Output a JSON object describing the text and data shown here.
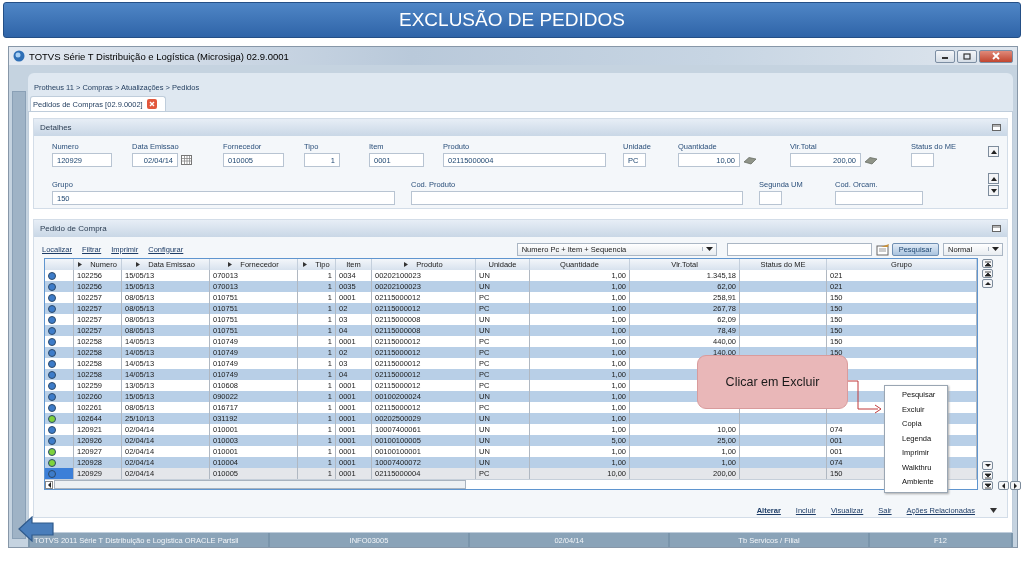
{
  "slide_title": "EXCLUSÃO DE PEDIDOS",
  "window": {
    "title": "TOTVS Série T Distribuição e Logística (Microsiga) 02.9.0001"
  },
  "breadcrumb": "Protheus 11 > Compras  > Atualizações > Pedidos",
  "tab": {
    "label": "Pedidos de Compras [02.9.0002]",
    "selected": true
  },
  "details": {
    "title": "Detalhes",
    "fields": [
      {
        "label": "Numero",
        "value": "120929",
        "kind": "text"
      },
      {
        "label": "Data Emissao",
        "value": "02/04/14",
        "kind": "date"
      },
      {
        "label": "Fornecedor",
        "value": "010005",
        "kind": "text"
      },
      {
        "label": "Tipo",
        "value": "1",
        "kind": "number"
      },
      {
        "label": "Item",
        "value": "0001",
        "kind": "text"
      },
      {
        "label": "Produto",
        "value": "02115000004",
        "kind": "text"
      },
      {
        "label": "Unidade",
        "value": "PC",
        "kind": "text"
      },
      {
        "label": "Quantidade",
        "value": "10,00",
        "kind": "amount"
      },
      {
        "label": "Vlr.Total",
        "value": "200,00",
        "kind": "amount"
      },
      {
        "label": "Status do ME",
        "kind": "text"
      },
      {
        "label": "Grupo",
        "value": "150",
        "kind": "text"
      },
      {
        "label": "Cod. Produto",
        "kind": "text"
      },
      {
        "label": "Segunda UM",
        "kind": "text"
      },
      {
        "label": "Cod. Orcam.",
        "kind": "text"
      }
    ]
  },
  "orders": {
    "title": "Pedido de Compra",
    "links": [
      "Localizar",
      "Filtrar",
      "Imprimir",
      "Configurar"
    ],
    "index_select": "Numero Pc + Item + Sequencia",
    "search_button": "Pesquisar",
    "mode_select": "Normal",
    "columns": [
      {
        "label": "Numero",
        "sortable": true
      },
      {
        "label": "Data Emissao",
        "sortable": true
      },
      {
        "label": "Fornecedor",
        "sortable": true
      },
      {
        "label": "Tipo",
        "sortable": true
      },
      {
        "label": "Item",
        "sortable": false
      },
      {
        "label": "Produto",
        "sortable": true
      },
      {
        "label": "Unidade",
        "sortable": false
      },
      {
        "label": "Quantidade",
        "sortable": false
      },
      {
        "label": "Vlr.Total",
        "sortable": false
      },
      {
        "label": "Status do ME",
        "sortable": false
      },
      {
        "label": "Grupo",
        "sortable": false
      }
    ],
    "rows": [
      {
        "color": "#3d7cc9",
        "selected": false,
        "cells": [
          "102256",
          "15/05/13",
          "070013",
          "1",
          "0034",
          "00202100023",
          "UN",
          "1,00",
          "1.345,18",
          null,
          "021"
        ]
      },
      {
        "color": "#3d7cc9",
        "selected": false,
        "cells": [
          "102256",
          "15/05/13",
          "070013",
          "1",
          "0035",
          "00202100023",
          "UN",
          "1,00",
          "62,00",
          null,
          "021"
        ]
      },
      {
        "color": "#3d7cc9",
        "selected": false,
        "cells": [
          "102257",
          "08/05/13",
          "010751",
          "1",
          "0001",
          "02115000012",
          "PC",
          "1,00",
          "258,91",
          null,
          "150"
        ]
      },
      {
        "color": "#3d7cc9",
        "selected": false,
        "cells": [
          "102257",
          "08/05/13",
          "010751",
          "1",
          "02",
          "02115000012",
          "PC",
          "1,00",
          "267,78",
          null,
          "150"
        ]
      },
      {
        "color": "#3d7cc9",
        "selected": false,
        "cells": [
          "102257",
          "08/05/13",
          "010751",
          "1",
          "03",
          "02115000008",
          "UN",
          "1,00",
          "62,09",
          null,
          "150"
        ]
      },
      {
        "color": "#3d7cc9",
        "selected": false,
        "cells": [
          "102257",
          "08/05/13",
          "010751",
          "1",
          "04",
          "02115000008",
          "UN",
          "1,00",
          "78,49",
          null,
          "150"
        ]
      },
      {
        "color": "#3d7cc9",
        "selected": false,
        "cells": [
          "102258",
          "14/05/13",
          "010749",
          "1",
          "0001",
          "02115000012",
          "PC",
          "1,00",
          "440,00",
          null,
          "150"
        ]
      },
      {
        "color": "#3d7cc9",
        "selected": false,
        "cells": [
          "102258",
          "14/05/13",
          "010749",
          "1",
          "02",
          "02115000012",
          "PC",
          "1,00",
          "140,00",
          null,
          "150"
        ]
      },
      {
        "color": "#3d7cc9",
        "selected": false,
        "cells": [
          "102258",
          "14/05/13",
          "010749",
          "1",
          "03",
          "02115000012",
          "PC",
          "1,00",
          null,
          null,
          null
        ]
      },
      {
        "color": "#3d7cc9",
        "selected": false,
        "cells": [
          "102258",
          "14/05/13",
          "010749",
          "1",
          "04",
          "02115000012",
          "PC",
          "1,00",
          null,
          null,
          null
        ]
      },
      {
        "color": "#3d7cc9",
        "selected": false,
        "cells": [
          "102259",
          "13/05/13",
          "010608",
          "1",
          "0001",
          "02115000012",
          "PC",
          "1,00",
          null,
          null,
          null
        ]
      },
      {
        "color": "#3d7cc9",
        "selected": false,
        "cells": [
          "102260",
          "15/05/13",
          "090022",
          "1",
          "0001",
          "00100200024",
          "UN",
          "1,00",
          null,
          null,
          null
        ]
      },
      {
        "color": "#3d7cc9",
        "selected": false,
        "cells": [
          "102261",
          "08/05/13",
          "016717",
          "1",
          "0001",
          "02115000012",
          "PC",
          "1,00",
          null,
          null,
          null
        ]
      },
      {
        "color": "#7ed23c",
        "selected": false,
        "cells": [
          "102644",
          "25/10/13",
          "031192",
          "1",
          "0001",
          "00202500029",
          "UN",
          "1,00",
          null,
          null,
          null
        ]
      },
      {
        "color": "#3d7cc9",
        "selected": false,
        "cells": [
          "120921",
          "02/04/14",
          "010001",
          "1",
          "0001",
          "10007400061",
          "UN",
          "1,00",
          "10,00",
          null,
          "074"
        ]
      },
      {
        "color": "#3d7cc9",
        "selected": false,
        "cells": [
          "120926",
          "02/04/14",
          "010003",
          "1",
          "0001",
          "00100100005",
          "UN",
          "5,00",
          "25,00",
          null,
          "001"
        ]
      },
      {
        "color": "#7ed23c",
        "selected": false,
        "cells": [
          "120927",
          "02/04/14",
          "010001",
          "1",
          "0001",
          "00100100001",
          "UN",
          "1,00",
          "1,00",
          null,
          "001"
        ]
      },
      {
        "color": "#7ed23c",
        "selected": false,
        "cells": [
          "120928",
          "02/04/14",
          "010004",
          "1",
          "0001",
          "10007400072",
          "UN",
          "1,00",
          "1,00",
          null,
          "074"
        ]
      },
      {
        "color": "#3d7cc9",
        "selected": true,
        "cells": [
          "120929",
          "02/04/14",
          "010005",
          "1",
          "0001",
          "02115000004",
          "PC",
          "10,00",
          "200,00",
          null,
          "150"
        ]
      }
    ],
    "actions": [
      {
        "label": "Alterar",
        "default": true
      },
      {
        "label": "Incluir",
        "default": false
      },
      {
        "label": "Visualizar",
        "default": false
      },
      {
        "label": "Sair",
        "default": false
      },
      {
        "label": "Ações Relacionadas",
        "default": false
      }
    ]
  },
  "context_menu": [
    "Pesquisar",
    "Excluir",
    "Copia",
    "Legenda",
    "Imprimir",
    "Walkthru",
    "Ambiente"
  ],
  "callout": {
    "text": "Clicar em Excluir"
  },
  "status_bar": [
    "TOTVS 2011 Série T Distribuição e Logística ORACLE Partsil",
    "INFO03005",
    "02/04/14",
    "Tb Servicos / Filial",
    "F12"
  ]
}
